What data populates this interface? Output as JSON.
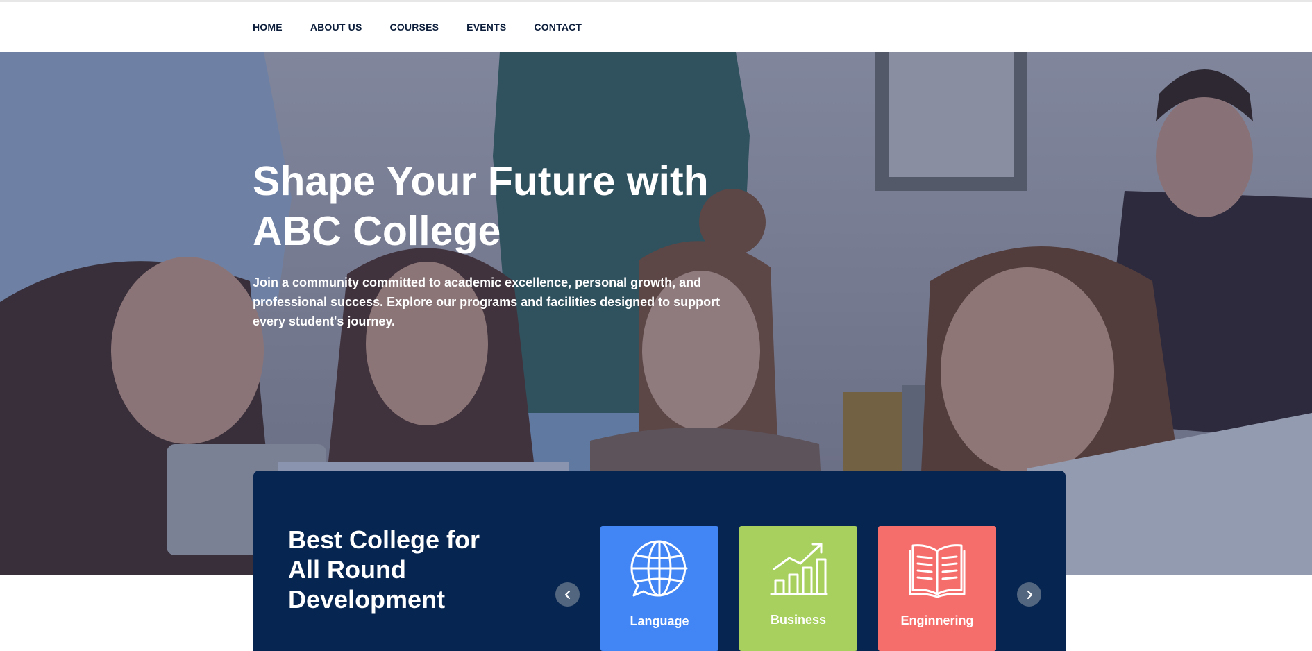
{
  "nav": {
    "items": [
      "HOME",
      "ABOUT US",
      "COURSES",
      "EVENTS",
      "CONTACT"
    ]
  },
  "hero": {
    "title": "Shape Your Future with ABC College",
    "text": "Join a community committed to academic excellence, personal growth, and professional success. Explore our programs and facilities designed to support every student's journey.",
    "background": "photo of students gathered around a laptop"
  },
  "features": {
    "heading": "Best College for All Round Development",
    "prev_icon": "chevron-left-icon",
    "next_icon": "chevron-right-icon",
    "cards": [
      {
        "label": "Language",
        "icon": "globe-chat-icon",
        "color": "#4285f4"
      },
      {
        "label": "Business",
        "icon": "bar-chart-growth-icon",
        "color": "#a8d05e"
      },
      {
        "label": "Enginnering",
        "icon": "open-book-icon",
        "color": "#f66e6b"
      }
    ]
  },
  "colors": {
    "nav_text": "#0b1d3a",
    "panel": "#062550",
    "arrow": "#52667f"
  }
}
